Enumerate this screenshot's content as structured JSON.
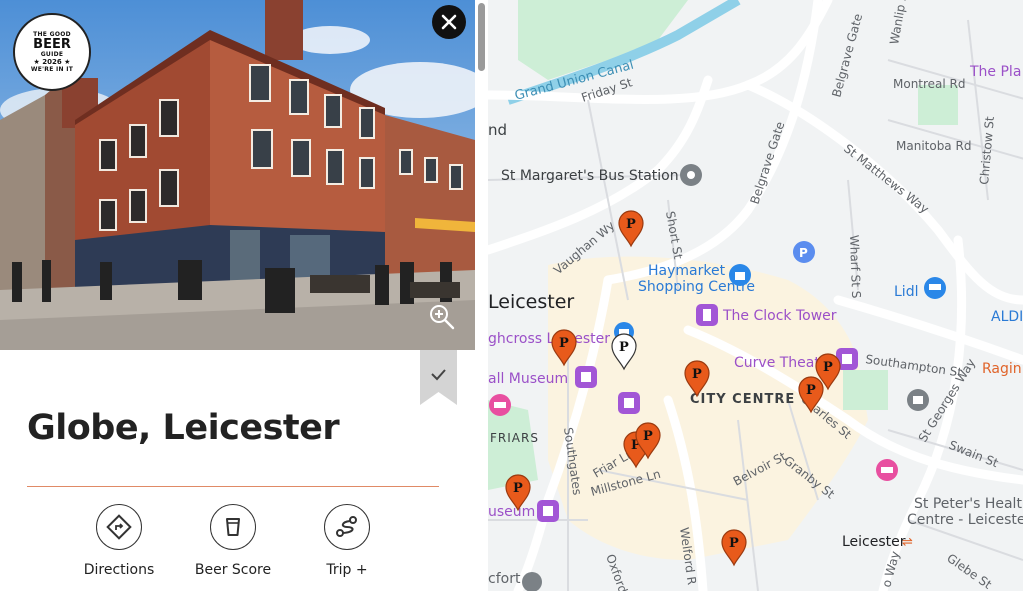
{
  "panel": {
    "badge": {
      "line1": "THE GOOD",
      "line2": "BEER",
      "line3": "GUIDE",
      "line4": "★ 2026 ★",
      "line5": "WE'RE IN IT"
    },
    "title": "Globe, Leicester",
    "actions": [
      {
        "label": "Directions",
        "icon": "directions-icon"
      },
      {
        "label": "Beer Score",
        "icon": "beer-glass-icon"
      },
      {
        "label": "Trip +",
        "icon": "trip-route-icon"
      }
    ],
    "close_icon": "close-icon",
    "zoom_icon": "zoom-in-icon",
    "bookmark_icon": "check-icon",
    "accent_color": "#e08a66"
  },
  "map": {
    "pin_color": "#e85a1b",
    "selected_pin_color": "#ffffff",
    "labels": {
      "canal": "Grand Union Canal",
      "friday_st": "Friday St",
      "belgrave_gate": "Belgrave Gate",
      "wanlip_st": "Wanlip St",
      "the_plaza": "The Pla",
      "montreal_rd": "Montreal Rd",
      "manitoba_rd": "Manitoba Rd",
      "christow_st": "Christow St",
      "st_matthews_way": "St Matthews Way",
      "nd": "nd",
      "bus_station": "St Margaret's Bus Station",
      "belgrave_gate2": "Belgrave Gate",
      "vaughan_wy": "Vaughan Wy",
      "short_st": "Short St",
      "wharf_st_s": "Wharf St S",
      "haymarket_1": "Haymarket",
      "haymarket_2": "Shopping Centre",
      "lidl": "Lidl",
      "leicester": "Leicester",
      "aldi": "ALDI",
      "clock_tower": "The Clock Tower",
      "highcross": "ghcross Leicester",
      "curve": "Curve Theatr",
      "southampton_st": "Southampton St",
      "ragin": "Ragin",
      "hall_museum": "all Museum",
      "city_centre": "CITY CENTRE",
      "charles_st": "Charles St",
      "st_georges_way": "St Georges Way",
      "friars": "FRIARS",
      "southgates": "Southgates",
      "friar_ln": "Friar Ln",
      "millstone_ln": "Millstone Ln",
      "belvoir_st": "Belvoir St",
      "granby_st": "Granby St",
      "swain_st": "Swain St",
      "st_peters_1": "St Peter's Health",
      "st_peters_2": "Centre - Leiceste",
      "museum": "useum",
      "leicester_station": "Leicester",
      "welford_rd": "Welford R",
      "oxford": "Oxford",
      "o_way": "o Way",
      "glebe_st": "Glebe St",
      "cfort": "cfort"
    }
  }
}
